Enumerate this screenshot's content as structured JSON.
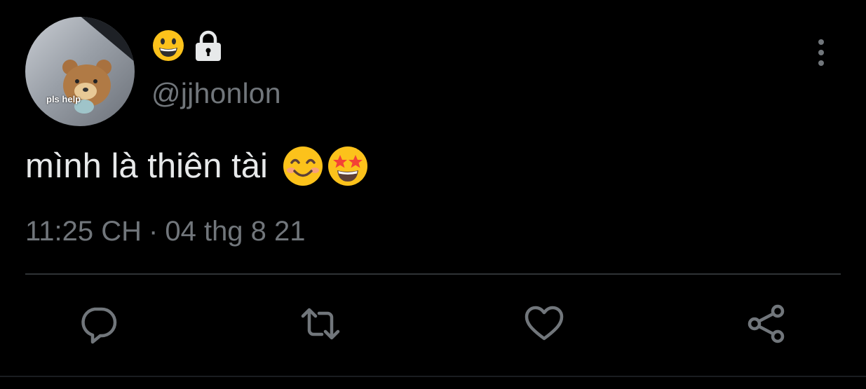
{
  "avatar": {
    "caption": "pls help"
  },
  "user": {
    "display_name_icons": [
      "grinning-face-emoji",
      "lock-icon"
    ],
    "handle": "@jjhonlon"
  },
  "tweet": {
    "text": "mình là thiên tài",
    "emojis": [
      "smiling-face-emoji",
      "star-struck-emoji"
    ],
    "time": "11:25 CH",
    "separator": "·",
    "date": "04 thg 8 21"
  },
  "actions": [
    "reply-icon",
    "retweet-icon",
    "like-icon",
    "share-icon"
  ],
  "colors": {
    "background": "#000000",
    "primary_text": "#e7e9ea",
    "secondary_text": "#71767b",
    "divider": "#2f3336"
  }
}
